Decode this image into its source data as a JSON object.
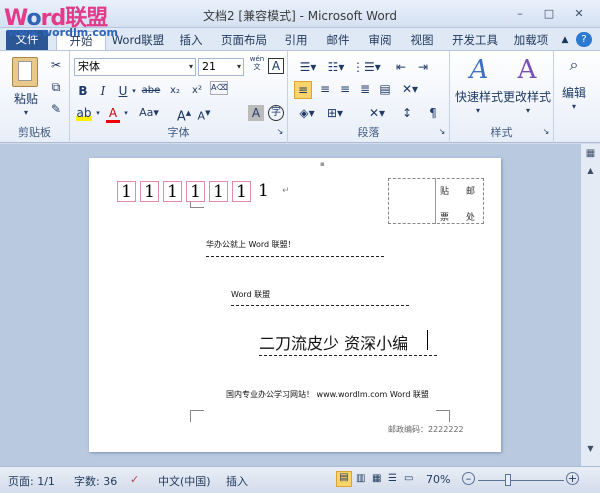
{
  "watermark": {
    "w": "W",
    "o": "o",
    "rd": "rd",
    "lianmeng": "联盟",
    "url": "www.wordlm.com"
  },
  "window": {
    "title": "文档2 [兼容模式] - Microsoft Word",
    "minimize": "–",
    "restore": "□",
    "close": "✕"
  },
  "tabs": [
    "文件",
    "开始",
    "Word联盟",
    "插入",
    "页面布局",
    "引用",
    "邮件",
    "审阅",
    "视图",
    "开发工具",
    "加载项"
  ],
  "ribbon": {
    "clipboard": {
      "paste": "粘贴",
      "label": "剪贴板"
    },
    "font": {
      "name": "宋体",
      "size": "21",
      "wen": "wén",
      "label": "字体",
      "bold": "B",
      "italic": "I",
      "underline": "U",
      "strike": "abe",
      "sub": "x₂",
      "sup": "x²",
      "grow": "A",
      "shrink": "A",
      "case": "Aa"
    },
    "paragraph": {
      "label": "段落"
    },
    "styles": {
      "quick": "快速样式",
      "change": "更改样式",
      "label": "样式"
    },
    "edit": {
      "label": "编辑"
    }
  },
  "document": {
    "postcode": [
      "1",
      "1",
      "1",
      "1",
      "1",
      "1",
      "1"
    ],
    "extra_digit": "1",
    "stamp": {
      "tie": "贴",
      "you": "邮",
      "piao": "票",
      "chu": "处"
    },
    "line1": "华办公就上 Word 联盟！",
    "line2": "Word 联盟",
    "line3": "二刀流皮少 资深小编",
    "line4": "国内专业办公学习网站！ www.wordlm.com Word 联盟",
    "line5": "邮政编码：2222222"
  },
  "status": {
    "page": "页面: 1/1",
    "words": "字数: 36",
    "lang": "中文(中国)",
    "mode": "插入",
    "zoom": "70%",
    "minus": "–",
    "plus": "+"
  }
}
